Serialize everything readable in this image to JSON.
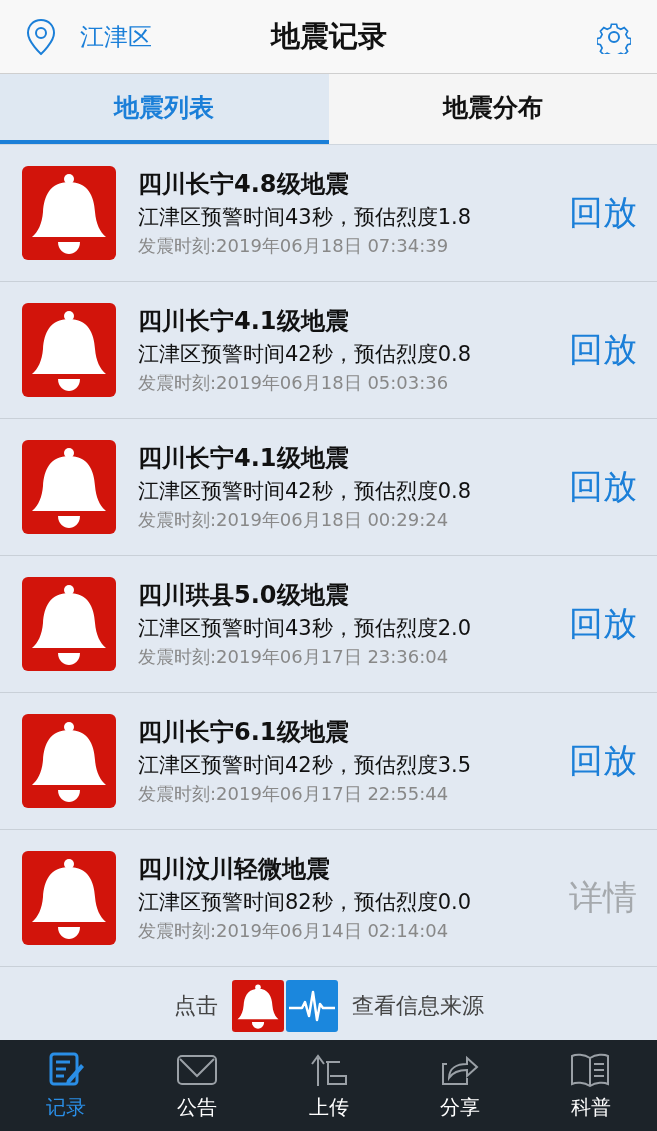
{
  "header": {
    "location": "江津区",
    "title": "地震记录"
  },
  "tabs": [
    {
      "label": "地震列表",
      "selected": true
    },
    {
      "label": "地震分布",
      "selected": false
    }
  ],
  "events": [
    {
      "title": "四川长宁4.8级地震",
      "warning": "江津区预警时间43秒，预估烈度1.8",
      "time": "发震时刻:2019年06月18日 07:34:39",
      "action": {
        "kind": "replay",
        "label": "回放"
      }
    },
    {
      "title": "四川长宁4.1级地震",
      "warning": "江津区预警时间42秒，预估烈度0.8",
      "time": "发震时刻:2019年06月18日 05:03:36",
      "action": {
        "kind": "replay",
        "label": "回放"
      }
    },
    {
      "title": "四川长宁4.1级地震",
      "warning": "江津区预警时间42秒，预估烈度0.8",
      "time": "发震时刻:2019年06月18日 00:29:24",
      "action": {
        "kind": "replay",
        "label": "回放"
      }
    },
    {
      "title": "四川珙县5.0级地震",
      "warning": "江津区预警时间43秒，预估烈度2.0",
      "time": "发震时刻:2019年06月17日 23:36:04",
      "action": {
        "kind": "replay",
        "label": "回放"
      }
    },
    {
      "title": "四川长宁6.1级地震",
      "warning": "江津区预警时间42秒，预估烈度3.5",
      "time": "发震时刻:2019年06月17日 22:55:44",
      "action": {
        "kind": "replay",
        "label": "回放"
      }
    },
    {
      "title": "四川汶川轻微地震",
      "warning": "江津区预警时间82秒，预估烈度0.0",
      "time": "发震时刻:2019年06月14日 02:14:04",
      "action": {
        "kind": "details",
        "label": "详情"
      }
    }
  ],
  "source_hint": {
    "before": "点击",
    "after": "查看信息来源"
  },
  "nav": [
    {
      "kind": "records",
      "label": "记录",
      "selected": true
    },
    {
      "kind": "notices",
      "label": "公告",
      "selected": false
    },
    {
      "kind": "upload",
      "label": "上传",
      "selected": false
    },
    {
      "kind": "share",
      "label": "分享",
      "selected": false
    },
    {
      "kind": "science",
      "label": "科普",
      "selected": false
    }
  ]
}
